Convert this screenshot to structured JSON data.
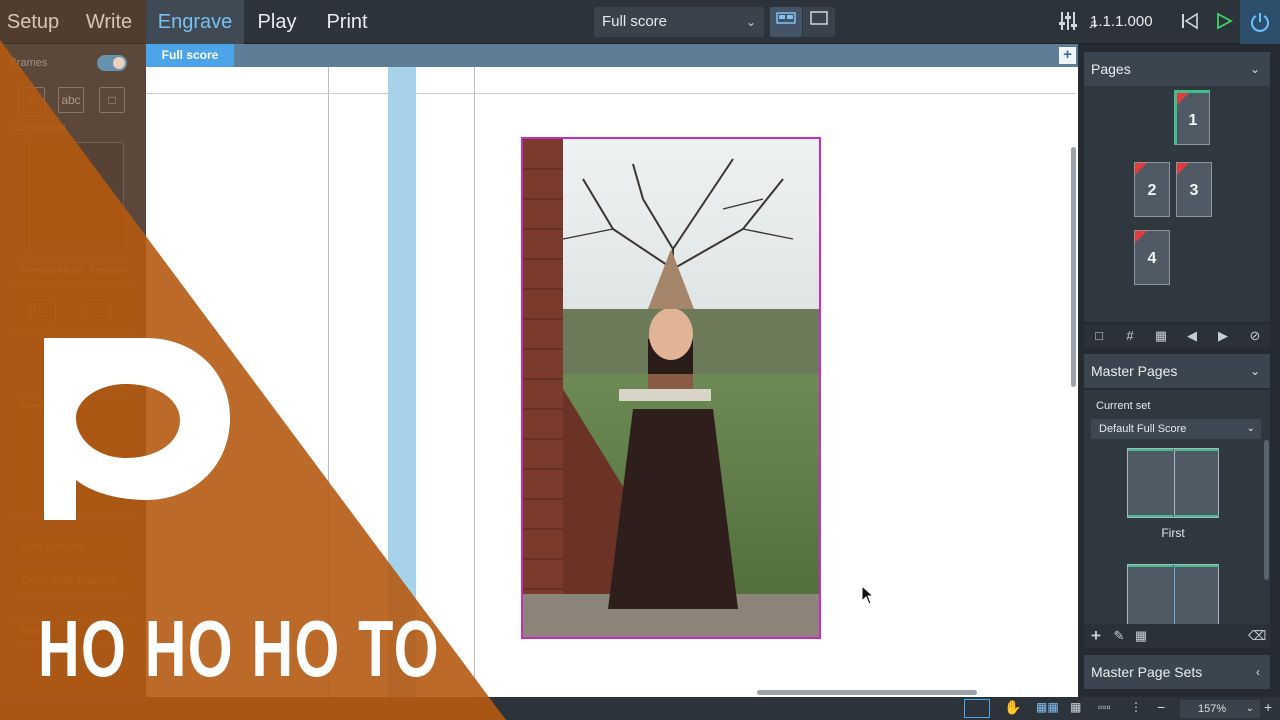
{
  "modes": [
    "Setup",
    "Write",
    "Engrave",
    "Play",
    "Print"
  ],
  "active_mode": "Engrave",
  "layout_select": {
    "value": "Full score"
  },
  "transport": {
    "position": "1.1.1.000"
  },
  "left_panel": {
    "frames_label": "Frames",
    "constraints_label": "Constraints",
    "format_music_frames_label": "Format Music Frames",
    "format_label": "Form",
    "staff_spacing_label": "Staff Spacing",
    "copy_staff_spacing_label": "Copy Staff Spacing...",
    "notes_label": "Note"
  },
  "tabstrip": {
    "tab_label": "Full score",
    "add_label": "+"
  },
  "right_panel": {
    "pages_title": "Pages",
    "pages": [
      "1",
      "2",
      "3",
      "4"
    ],
    "master_pages_title": "Master Pages",
    "current_set_label": "Current set",
    "current_set_value": "Default Full Score",
    "first_label": "First",
    "master_page_sets_title": "Master Page Sets"
  },
  "statusbar": {
    "zoom": "157%"
  },
  "overlay": {
    "title": "HO HO HO TO"
  },
  "colors": {
    "accent": "#79c0f0",
    "overlay_orange": "#b55a12",
    "frame_magenta": "#c72ec0",
    "page_corner_red": "#e23b3b",
    "current_green": "#3fbf8c"
  }
}
